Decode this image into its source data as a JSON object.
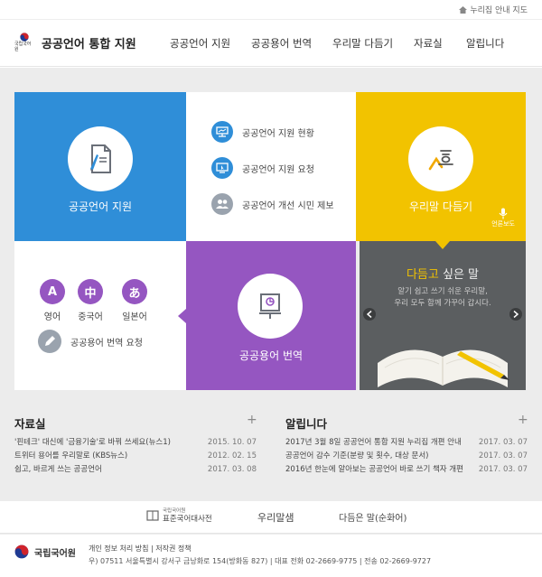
{
  "topbar": {
    "sitemap_label": "누리집 안내 지도"
  },
  "header": {
    "logo_sub": "국립국어원",
    "site_title": "공공언어 통합 지원",
    "nav": [
      "공공언어 지원",
      "공공용어 번역",
      "우리말 다듬기",
      "자료실",
      "알립니다"
    ]
  },
  "tiles": {
    "public_language_support": "공공언어 지원",
    "services": [
      "공공언어 지원 현황",
      "공공언어 지원 요청",
      "공공언어 개선 시민 제보"
    ],
    "refine_korean": "우리말 다듬기",
    "press_label": "언론보도",
    "public_term_translation": "공공용어 번역",
    "languages": [
      {
        "glyph": "A",
        "label": "영어"
      },
      {
        "glyph": "中",
        "label": "중국어"
      },
      {
        "glyph": "あ",
        "label": "일본어"
      }
    ],
    "translation_request": "공공용어 번역 요청"
  },
  "banner": {
    "title_highlight": "다듬고",
    "title_rest": " 싶은 말",
    "text_line1": "알기 쉽고 쓰기 쉬운 우리말,",
    "text_line2": "우리 모두 함께 가꾸어 갑시다."
  },
  "resources": {
    "title": "자료실",
    "items": [
      {
        "text": "'핀테크' 대신에 '금융기술'로 바꿔 쓰세요(뉴스1)",
        "date": "2015. 10. 07"
      },
      {
        "text": "트위터 용어를 우리말로 (KBS뉴스)",
        "date": "2012. 02. 15"
      },
      {
        "text": "쉽고, 바르게 쓰는 공공언어",
        "date": "2017. 03. 08"
      }
    ]
  },
  "notices": {
    "title": "알립니다",
    "items": [
      {
        "text": "2017년 3월 8일 공공언어 통합 지원 누리집 개편 안내",
        "date": "2017. 03. 07"
      },
      {
        "text": "공공언어 감수 기준(분량 및 횟수, 대상 문서)",
        "date": "2017. 03. 07"
      },
      {
        "text": "2016년 한눈에 알아보는 공공언어 바로 쓰기 책자 개편",
        "date": "2017. 03. 07"
      }
    ]
  },
  "partners": {
    "dictionary_sub": "국립국어원",
    "dictionary": "표준국어대사전",
    "urimalsaem": "우리말샘",
    "other_words": "다듬은 말(순화어)"
  },
  "footer": {
    "logo_text": "국립국어원",
    "links": "개인 정보 처리 방침 | 저작권 정책",
    "address": "우) 07511 서울특별시 강서구 금낭화로 154(방화동 827) | 대표 전화 02-2669-9775 | 전송 02-2669-9727"
  },
  "colors": {
    "blue": "#2f8ed8",
    "yellow": "#f2c300",
    "purple": "#9556c1",
    "banner": "#5b5e60"
  }
}
